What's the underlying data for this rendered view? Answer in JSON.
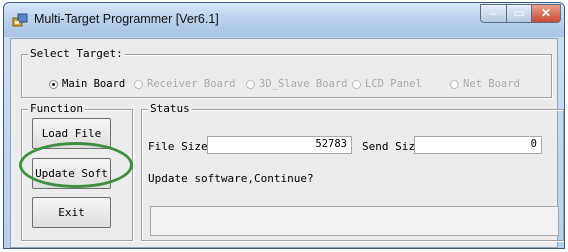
{
  "window": {
    "title": "Multi-Target Programmer [Ver6.1]"
  },
  "titlebar_buttons": {
    "minimize": "–",
    "maximize": "▭",
    "close": "✕"
  },
  "select_target": {
    "label": "Select Target:",
    "options": [
      {
        "label": "Main Board",
        "selected": true,
        "enabled": true
      },
      {
        "label": "Receiver Board",
        "selected": false,
        "enabled": false
      },
      {
        "label": "3D_Slave Board",
        "selected": false,
        "enabled": false
      },
      {
        "label": "LCD Panel",
        "selected": false,
        "enabled": false
      },
      {
        "label": "Net Board",
        "selected": false,
        "enabled": false
      }
    ]
  },
  "function": {
    "label": "Function",
    "load_file": "Load File",
    "update_soft": "Update Soft",
    "exit": "Exit"
  },
  "status": {
    "label": "Status",
    "file_size_label": "File Size:",
    "file_size_value": "52783",
    "send_size_label": "Send Size",
    "send_size_value": "0",
    "message": "Update software,Continue?",
    "status_bar_text": ""
  },
  "colors": {
    "highlight_ring": "#3e8f3e",
    "title_bar": "#bcd2ec",
    "close_button": "#c84a30"
  }
}
